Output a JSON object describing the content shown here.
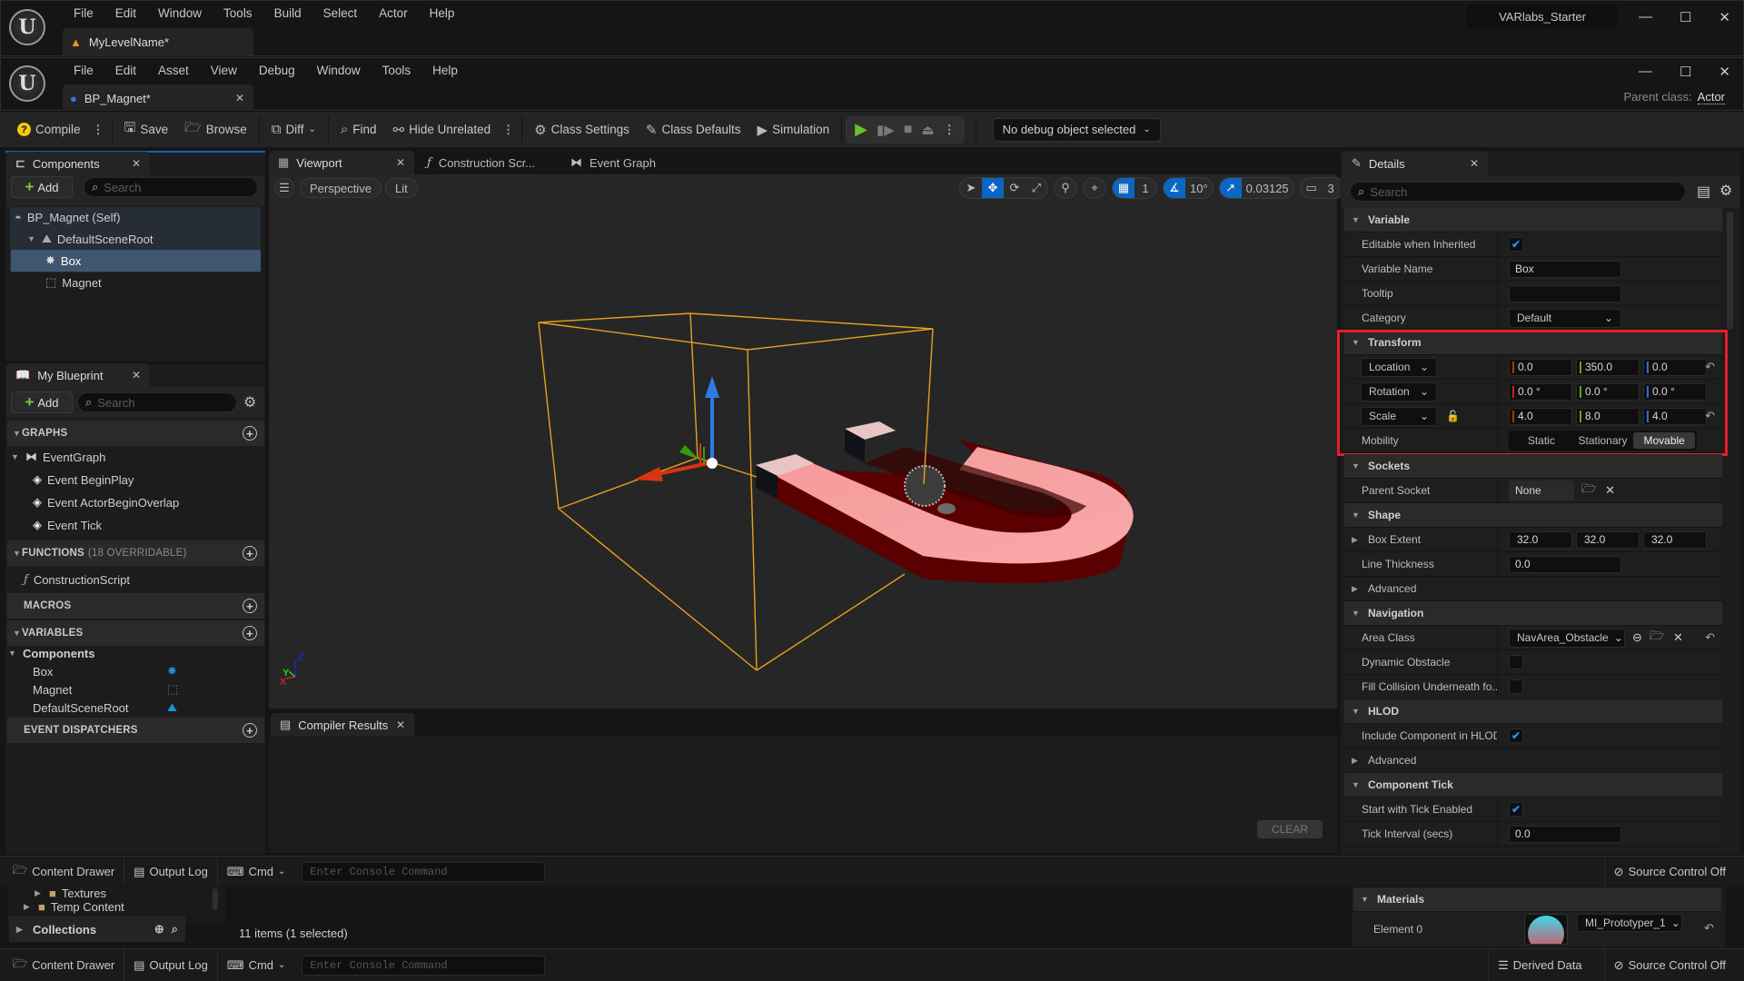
{
  "level_window": {
    "menu": [
      "File",
      "Edit",
      "Window",
      "Tools",
      "Build",
      "Select",
      "Actor",
      "Help"
    ],
    "tab_label": "MyLevelName*",
    "project_name": "VARlabs_Starter"
  },
  "bp_window": {
    "menu": [
      "File",
      "Edit",
      "Asset",
      "View",
      "Debug",
      "Window",
      "Tools",
      "Help"
    ],
    "tab_label": "BP_Magnet*",
    "parent_class_label": "Parent class:",
    "parent_class_value": "Actor"
  },
  "toolbar": {
    "compile": "Compile",
    "save": "Save",
    "browse": "Browse",
    "diff": "Diff",
    "find": "Find",
    "hide_unrelated": "Hide Unrelated",
    "class_settings": "Class Settings",
    "class_defaults": "Class Defaults",
    "simulation": "Simulation",
    "debug_object": "No debug object selected"
  },
  "components_panel": {
    "title": "Components",
    "add_label": "Add",
    "search_placeholder": "Search",
    "items": [
      {
        "label": "BP_Magnet (Self)"
      },
      {
        "label": "DefaultSceneRoot"
      },
      {
        "label": "Box",
        "selected": true
      },
      {
        "label": "Magnet"
      }
    ]
  },
  "my_blueprint": {
    "title": "My Blueprint",
    "add_label": "Add",
    "search_placeholder": "Search",
    "graphs_label": "GRAPHS",
    "event_graph": "EventGraph",
    "events": [
      "Event BeginPlay",
      "Event ActorBeginOverlap",
      "Event Tick"
    ],
    "functions_label": "FUNCTIONS",
    "functions_note": "(18 OVERRIDABLE)",
    "construction_script": "ConstructionScript",
    "macros_label": "MACROS",
    "variables_label": "VARIABLES",
    "components_group": "Components",
    "variables": [
      "Box",
      "Magnet",
      "DefaultSceneRoot"
    ],
    "dispatchers_label": "EVENT DISPATCHERS"
  },
  "editor_tabs": {
    "viewport": "Viewport",
    "construction": "Construction Scr...",
    "event_graph": "Event Graph"
  },
  "viewport": {
    "perspective": "Perspective",
    "lit": "Lit",
    "grid_snap": "1",
    "rotation_snap": "10°",
    "scale_snap": "0.03125",
    "camera_speed": "3",
    "axis_labels": {
      "x": "X",
      "y": "Y",
      "z": "Z"
    }
  },
  "compiler": {
    "title": "Compiler Results",
    "clear": "CLEAR"
  },
  "details": {
    "title": "Details",
    "search_placeholder": "Search",
    "variable": {
      "header": "Variable",
      "editable_label": "Editable when Inherited",
      "editable": true,
      "name_label": "Variable Name",
      "name_value": "Box",
      "tooltip_label": "Tooltip",
      "tooltip_value": "",
      "category_label": "Category",
      "category_value": "Default"
    },
    "transform": {
      "header": "Transform",
      "location_label": "Location",
      "location": [
        "0.0",
        "350.0",
        "0.0"
      ],
      "rotation_label": "Rotation",
      "rotation": [
        "0.0 °",
        "0.0 °",
        "0.0 °"
      ],
      "scale_label": "Scale",
      "scale": [
        "4.0",
        "8.0",
        "4.0"
      ],
      "mobility_label": "Mobility",
      "mobility_options": [
        "Static",
        "Stationary",
        "Movable"
      ],
      "mobility_selected": "Movable"
    },
    "sockets": {
      "header": "Sockets",
      "parent_label": "Parent Socket",
      "parent_value": "None"
    },
    "shape": {
      "header": "Shape",
      "extent_label": "Box Extent",
      "extent": [
        "32.0",
        "32.0",
        "32.0"
      ],
      "thickness_label": "Line Thickness",
      "thickness_value": "0.0",
      "advanced": "Advanced"
    },
    "navigation": {
      "header": "Navigation",
      "area_label": "Area Class",
      "area_value": "NavArea_Obstacle",
      "dynamic_label": "Dynamic Obstacle",
      "dynamic": false,
      "fill_label": "Fill Collision Underneath fo...",
      "fill": false
    },
    "hlod": {
      "header": "HLOD",
      "include_label": "Include Component in HLOD",
      "include": true,
      "advanced": "Advanced"
    },
    "tick": {
      "header": "Component Tick",
      "start_label": "Start with Tick Enabled",
      "start": true,
      "interval_label": "Tick Interval (secs)",
      "interval_value": "0.0"
    }
  },
  "bottom_bar": {
    "content_drawer": "Content Drawer",
    "output_log": "Output Log",
    "cmd": "Cmd",
    "console_placeholder": "Enter Console Command",
    "derived_data": "Derived Data",
    "source_control": "Source Control Off"
  },
  "content_browser": {
    "folders": [
      "Textures",
      "Temp Content"
    ],
    "collections": "Collections",
    "items_status": "11 items (1 selected)"
  },
  "materials": {
    "header": "Materials",
    "element_label": "Element 0",
    "element_value": "MI_Prototyper_1"
  }
}
